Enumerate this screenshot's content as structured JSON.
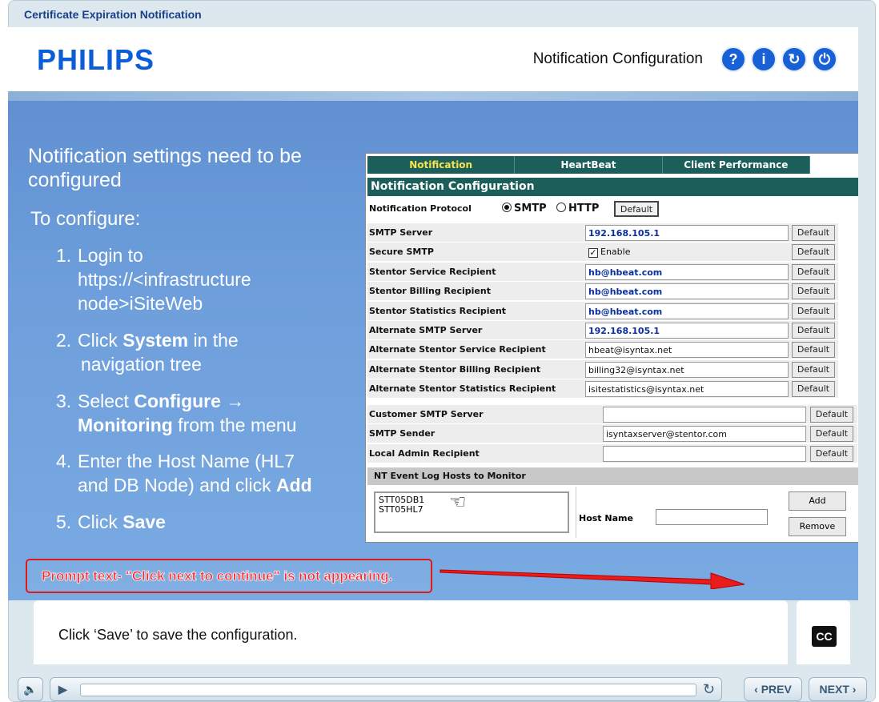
{
  "window": {
    "title": "Certificate Expiration Notification"
  },
  "header": {
    "logo": "PHILIPS",
    "title": "Notification Configuration",
    "icons": [
      {
        "name": "help-icon",
        "glyph": "?"
      },
      {
        "name": "info-icon",
        "glyph": "i"
      },
      {
        "name": "refresh-icon",
        "glyph": "↻"
      },
      {
        "name": "power-icon",
        "glyph": "⏻"
      }
    ]
  },
  "slide": {
    "intro": "Notification settings need to be configured",
    "to_configure": "To configure:",
    "steps": [
      {
        "num": "1.",
        "a": "Login to",
        "b": "https://<infrastructure node>iSiteWeb"
      },
      {
        "num": "2.",
        "a": "Click ",
        "bold1": "System",
        "a2": " in the",
        "b": "navigation tree"
      },
      {
        "num": "3.",
        "a": "Select ",
        "bold1": "Configure",
        "a2": " →",
        "bold2": "Monitoring",
        "b": " from the menu"
      },
      {
        "num": "4.",
        "a": "Enter the Host Name (HL7",
        "b": "and DB Node) and click ",
        "bold2": "Add"
      },
      {
        "num": "5.",
        "a": "Click ",
        "bold1": "Save"
      }
    ]
  },
  "panel": {
    "tabs": [
      "Notification",
      "HeartBeat",
      "Client Performance"
    ],
    "title": "Notification Configuration",
    "protocol": {
      "label": "Notification Protocol",
      "smtp": "SMTP",
      "http": "HTTP",
      "default": "Default"
    },
    "rows": [
      {
        "label": "SMTP Server",
        "value": "192.168.105.1",
        "style": "blue"
      },
      {
        "label": "Secure SMTP",
        "value": "Enable",
        "style": "check"
      },
      {
        "label": "Stentor Service Recipient",
        "value": "hb@hbeat.com",
        "style": "blue"
      },
      {
        "label": "Stentor Billing Recipient",
        "value": "hb@hbeat.com",
        "style": "blue"
      },
      {
        "label": "Stentor Statistics Recipient",
        "value": "hb@hbeat.com",
        "style": "blue"
      },
      {
        "label": "Alternate SMTP Server",
        "value": "192.168.105.1",
        "style": "blue"
      },
      {
        "label": "Alternate Stentor Service Recipient",
        "value": "hbeat@isyntax.net",
        "style": "plain"
      },
      {
        "label": "Alternate Stentor Billing Recipient",
        "value": "billing32@isyntax.net",
        "style": "plain"
      },
      {
        "label": "Alternate Stentor Statistics Recipient",
        "value": "isitestatistics@isyntax.net",
        "style": "plain"
      }
    ],
    "rows2": [
      {
        "label": "Customer SMTP Server",
        "value": ""
      },
      {
        "label": "SMTP Sender",
        "value": "isyntaxserver@stentor.com"
      },
      {
        "label": "Local Admin Recipient",
        "value": ""
      }
    ],
    "default_label": "Default",
    "nt_header": "NT Event Log Hosts to Monitor",
    "hosts": [
      "STT05DB1",
      "STT05HL7"
    ],
    "host_name_label": "Host Name",
    "add": "Add",
    "remove": "Remove"
  },
  "annotation": {
    "text": "Prompt text- \"Click next to continue\" is not appearing."
  },
  "caption": {
    "text": "Click ‘Save’ to save the configuration.",
    "cc": "CC"
  },
  "playbar": {
    "prev": "PREV",
    "next": "NEXT"
  }
}
